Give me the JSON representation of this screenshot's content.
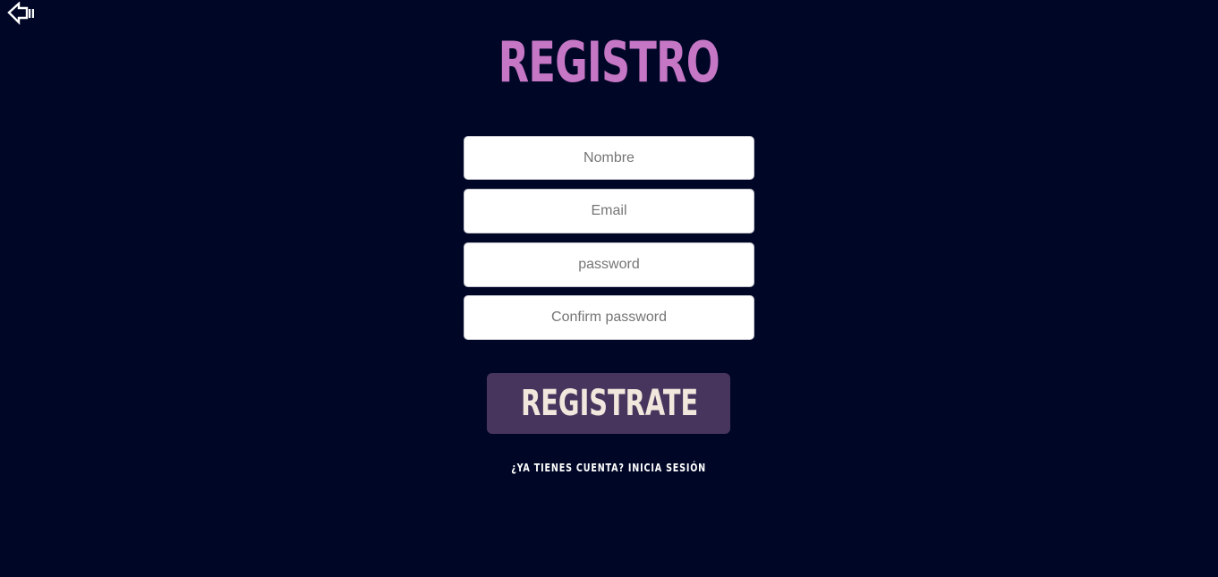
{
  "colors": {
    "background": "#000626",
    "title": "#c576c4",
    "button_bg": "#48355e",
    "button_text": "#f1e7dc",
    "link_text": "#ffffff",
    "back_icon": "#ffffff"
  },
  "header": {
    "back_icon": "back-arrow-icon",
    "title": "REGISTRO"
  },
  "form": {
    "name_placeholder": "Nombre",
    "email_placeholder": "Email",
    "password_placeholder": "password",
    "confirm_placeholder": "Confirm password",
    "submit_label": "REGISTRATE"
  },
  "footer": {
    "login_link": "¿YA TIENES CUENTA? INICIA SESIÓN"
  }
}
